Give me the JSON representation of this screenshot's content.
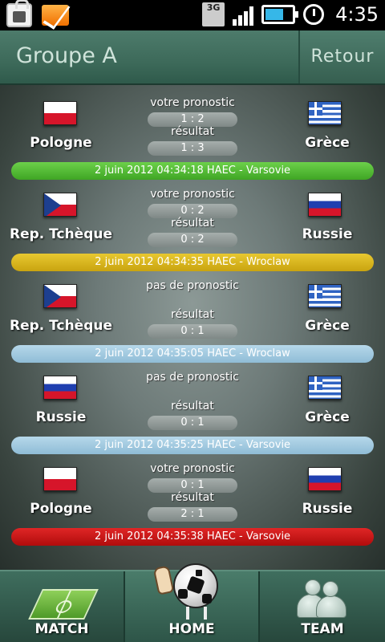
{
  "status_bar": {
    "network_type": "3G",
    "time": "4:35",
    "battery_level": 0.6,
    "icons": [
      "shopping-bag-icon",
      "mail-icon",
      "3g-data-icon",
      "signal-icon",
      "battery-icon",
      "alarm-icon"
    ]
  },
  "header": {
    "title": "Groupe A",
    "back_label": "Retour"
  },
  "matches": [
    {
      "team_left": "Pologne",
      "team_right": "Grèce",
      "flag_left": "poland-flag",
      "flag_right": "greece-flag",
      "prediction_label": "votre pronostic",
      "prediction_score": "1 : 2",
      "result_label": "résultat",
      "result_score": "1 : 3",
      "date_text": "2 juin 2012 04:34:18 HAEC - Varsovie",
      "status_color": "#4cb82f"
    },
    {
      "team_left": "Rep. Tchèque",
      "team_right": "Russie",
      "flag_left": "czech-flag",
      "flag_right": "russia-flag",
      "prediction_label": "votre pronostic",
      "prediction_score": "0 : 2",
      "result_label": "résultat",
      "result_score": "0 : 2",
      "date_text": "2 juin 2012 04:34:35 HAEC - Wroclaw",
      "status_color": "#d4b01a"
    },
    {
      "team_left": "Rep. Tchèque",
      "team_right": "Grèce",
      "flag_left": "czech-flag",
      "flag_right": "greece-flag",
      "prediction_label": "pas de pronostic",
      "prediction_score": "",
      "result_label": "résultat",
      "result_score": "0 : 1",
      "date_text": "2 juin 2012 04:35:05 HAEC - Wroclaw",
      "status_color": "#a3cae0"
    },
    {
      "team_left": "Russie",
      "team_right": "Grèce",
      "flag_left": "russia-flag",
      "flag_right": "greece-flag",
      "prediction_label": "pas de pronostic",
      "prediction_score": "",
      "result_label": "résultat",
      "result_score": "0 : 1",
      "date_text": "2 juin 2012 04:35:25 HAEC - Varsovie",
      "status_color": "#a3cae0"
    },
    {
      "team_left": "Pologne",
      "team_right": "Russie",
      "flag_left": "poland-flag",
      "flag_right": "russia-flag",
      "prediction_label": "votre pronostic",
      "prediction_score": "0 : 1",
      "result_label": "résultat",
      "result_score": "2 : 1",
      "date_text": "2 juin 2012 04:35:38 HAEC - Varsovie",
      "status_color": "#c81414"
    }
  ],
  "bottom_nav": {
    "match_label": "MATCH",
    "home_label": "HOME",
    "team_label": "TEAM"
  }
}
